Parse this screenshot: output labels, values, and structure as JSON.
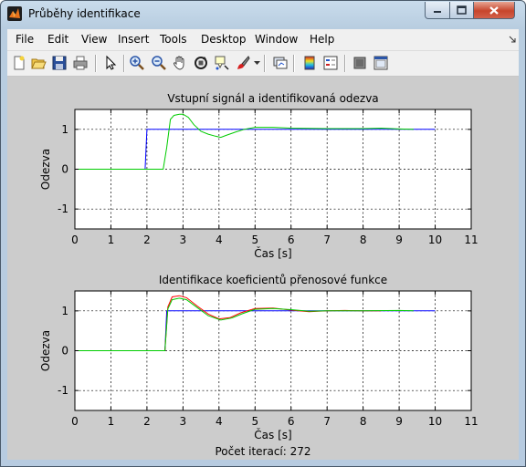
{
  "window": {
    "title": "Průběhy identifikace"
  },
  "menu": [
    "File",
    "Edit",
    "View",
    "Insert",
    "Tools",
    "Desktop",
    "Window",
    "Help"
  ],
  "toolbar_icons": [
    "new-figure-icon",
    "open-file-icon",
    "save-icon",
    "print-icon",
    "arrow-pointer-icon",
    "zoom-in-icon",
    "zoom-out-icon",
    "pan-hand-icon",
    "rotate-3d-icon",
    "data-cursor-icon",
    "brush-icon",
    "link-plot-icon",
    "colorbar-icon",
    "legend-icon",
    "hide-plot-tools-icon",
    "show-plot-tools-icon"
  ],
  "figure_footer": "Počet iterací: 272",
  "chart_data": [
    {
      "type": "line",
      "title": "Vstupní signál a identifikovaná odezva",
      "xlabel": "Čas [s]",
      "ylabel": "Odezva",
      "xlim": [
        0,
        11
      ],
      "ylim": [
        -1.5,
        1.5
      ],
      "xticks": [
        "0",
        "1",
        "2",
        "3",
        "4",
        "5",
        "6",
        "7",
        "8",
        "9",
        "10",
        "11"
      ],
      "yticks": [
        "1",
        "0",
        "-1"
      ],
      "grid": true,
      "series": [
        {
          "color": "#0000ff",
          "x": [
            0,
            1.95,
            2.0,
            10.0
          ],
          "y": [
            0,
            0,
            1,
            1
          ]
        },
        {
          "color": "#00cc00",
          "x": [
            0,
            2.45,
            2.55,
            2.65,
            2.75,
            2.9,
            3.0,
            3.15,
            3.3,
            3.5,
            3.7,
            3.9,
            4.05,
            4.2,
            4.45,
            4.7,
            5.0,
            5.5,
            6.0,
            7.0,
            8.0,
            8.5,
            9.0,
            9.4
          ],
          "y": [
            0,
            0,
            0.55,
            1.25,
            1.35,
            1.38,
            1.38,
            1.3,
            1.12,
            0.95,
            0.88,
            0.83,
            0.8,
            0.85,
            0.93,
            1.0,
            1.05,
            1.05,
            1.03,
            1.02,
            1.02,
            1.03,
            1.01,
            1.0
          ]
        }
      ]
    },
    {
      "type": "line",
      "title": "Identifikace koeficientů přenosové funkce",
      "xlabel": "Čas [s]",
      "ylabel": "Odezva",
      "xlim": [
        0,
        11
      ],
      "ylim": [
        -1.5,
        1.5
      ],
      "xticks": [
        "0",
        "1",
        "2",
        "3",
        "4",
        "5",
        "6",
        "7",
        "8",
        "9",
        "10",
        "11"
      ],
      "yticks": [
        "1",
        "0",
        "-1"
      ],
      "grid": true,
      "series": [
        {
          "color": "#0000ff",
          "x": [
            0,
            2.5,
            2.55,
            10.0
          ],
          "y": [
            0,
            0,
            1,
            1
          ]
        },
        {
          "color": "#ff0000",
          "x": [
            0,
            2.5,
            2.58,
            2.7,
            2.9,
            3.1,
            3.4,
            3.7,
            4.0,
            4.3,
            4.6,
            5.0,
            5.5,
            6.0,
            6.5,
            7.0,
            7.5,
            8.0,
            8.5
          ],
          "y": [
            0,
            0,
            1.1,
            1.35,
            1.38,
            1.33,
            1.12,
            0.92,
            0.8,
            0.83,
            0.95,
            1.06,
            1.07,
            1.02,
            0.98,
            1.0,
            1.01,
            1.0,
            1.0
          ]
        },
        {
          "color": "#00cc00",
          "x": [
            0,
            2.5,
            2.58,
            2.7,
            2.9,
            3.1,
            3.4,
            3.7,
            4.05,
            4.35,
            4.65,
            5.0,
            5.5,
            6.0,
            6.5,
            7.0,
            8.0,
            9.0,
            9.4
          ],
          "y": [
            0,
            0,
            1.05,
            1.28,
            1.32,
            1.28,
            1.08,
            0.88,
            0.77,
            0.82,
            0.93,
            1.04,
            1.06,
            1.03,
            0.99,
            1.0,
            1.0,
            1.01,
            1.0
          ]
        }
      ]
    }
  ]
}
